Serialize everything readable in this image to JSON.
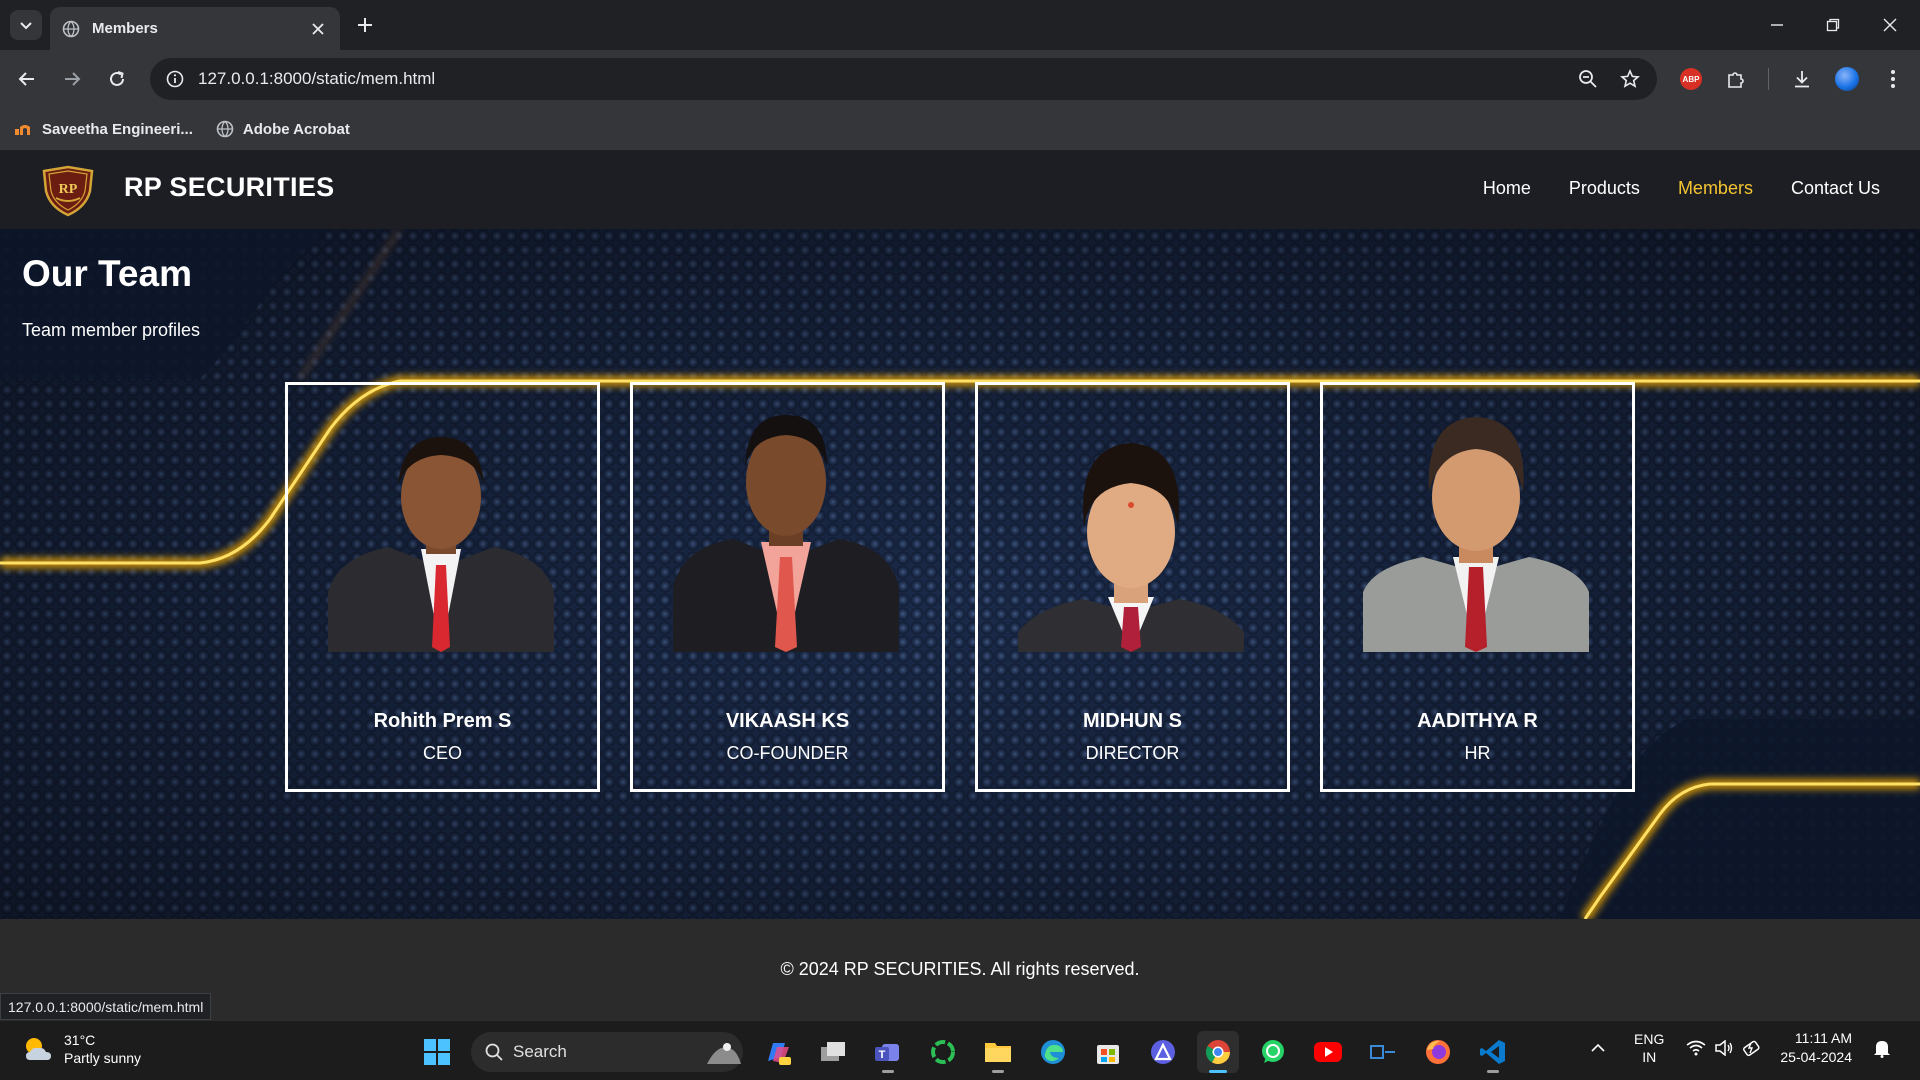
{
  "browser": {
    "tab_title": "Members",
    "url": "127.0.0.1:8000/static/mem.html",
    "bookmarks": [
      {
        "label": "Saveetha Engineeri...",
        "icon": "saveetha-favicon"
      },
      {
        "label": "Adobe Acrobat",
        "icon": "globe-icon"
      }
    ],
    "extension_badge": "ABP",
    "status_url": "127.0.0.1:8000/static/mem.html"
  },
  "site": {
    "logo_text": "RP",
    "title": "RP SECURITIES",
    "nav": [
      {
        "label": "Home",
        "active": false
      },
      {
        "label": "Products",
        "active": false
      },
      {
        "label": "Members",
        "active": true
      },
      {
        "label": "Contact Us",
        "active": false
      }
    ],
    "accent_color": "#f4c430"
  },
  "team": {
    "title": "Our Team",
    "subtitle": "Team member profiles",
    "members": [
      {
        "name": "Rohith Prem S",
        "role": "CEO"
      },
      {
        "name": "VIKAASH KS",
        "role": "CO-FOUNDER"
      },
      {
        "name": "MIDHUN S",
        "role": "DIRECTOR"
      },
      {
        "name": "AADITHYA R",
        "role": "HR"
      }
    ]
  },
  "footer": {
    "text": "© 2024 RP SECURITIES. All rights reserved."
  },
  "taskbar": {
    "weather_temp": "31°C",
    "weather_desc": "Partly sunny",
    "search_label": "Search",
    "lang_line1": "ENG",
    "lang_line2": "IN",
    "time": "11:11 AM",
    "date": "25-04-2024"
  }
}
